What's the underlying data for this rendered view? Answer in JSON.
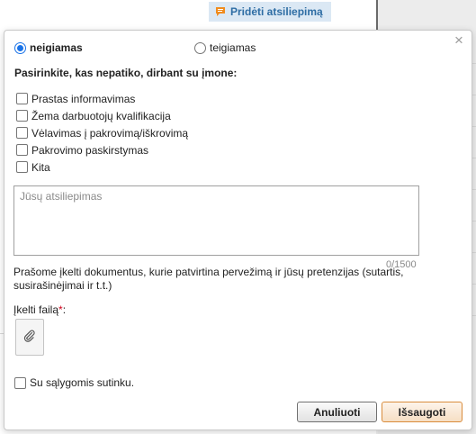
{
  "header": {
    "add_review_label": "Pridėti atsiliepimą",
    "add_review_icon": "comment-icon",
    "accent_color": "#2e6da4",
    "icon_color": "#f08c1e"
  },
  "dialog": {
    "close_icon": "close-icon",
    "rating": {
      "negative_label": "neigiamas",
      "positive_label": "teigiamas",
      "selected": "neigiamas"
    },
    "prompt": "Pasirinkite, kas nepatiko, dirbant su įmone:",
    "reasons": [
      "Prastas informavimas",
      "Žema darbuotojų kvalifikacija",
      "Vėlavimas į pakrovimą/iškrovimą",
      "Pakrovimo paskirstymas",
      "Kita"
    ],
    "feedback": {
      "placeholder": "Jūsų atsiliepimas",
      "value": "",
      "char_count": "0/1500"
    },
    "upload_note": "Prašome įkelti dokumentus, kurie patvirtina pervežimą ir jūsų pretenzijas (sutartis, susirašinėjimai ir t.t.)",
    "upload_label": "Įkelti failą",
    "required_mark": "*",
    "upload_colon": ":",
    "attach_icon": "paperclip-icon",
    "terms_label": "Su sąlygomis sutinku.",
    "buttons": {
      "cancel": "Anuliuoti",
      "save": "Išsaugoti",
      "save_border_color": "#d98c3c"
    }
  }
}
